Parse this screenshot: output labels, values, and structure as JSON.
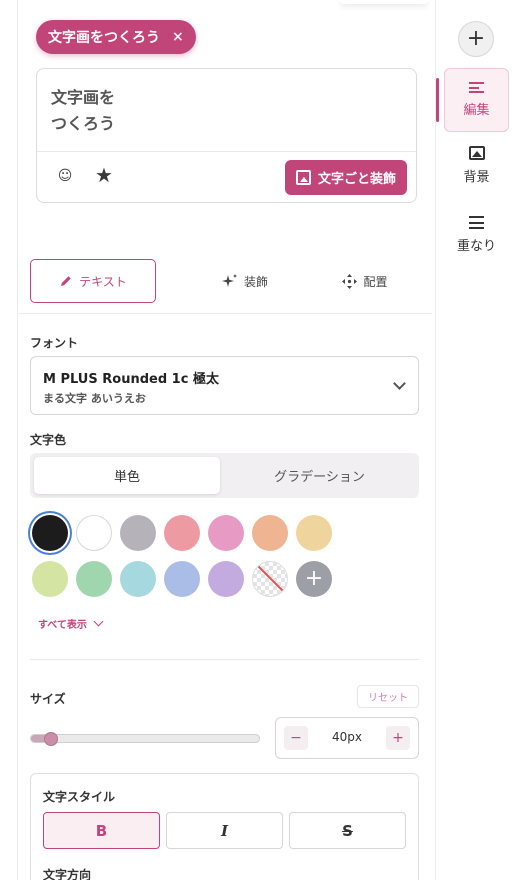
{
  "chip": {
    "label": "文字画をつくろう",
    "close": "×"
  },
  "editor": {
    "text": "文字画を\nつくろう",
    "emoji_icon": "☺",
    "star_icon": "★",
    "decorate_button": "文字ごと装飾"
  },
  "tabs": [
    {
      "label": "テキスト",
      "icon": "pencil-icon"
    },
    {
      "label": "装飾",
      "icon": "sparkle-icon"
    },
    {
      "label": "配置",
      "icon": "move-icon"
    }
  ],
  "font": {
    "label": "フォント",
    "name": "M PLUS Rounded 1c 極太",
    "sample": "まる文字 あいうえお"
  },
  "color": {
    "label": "文字色",
    "modes": [
      "単色",
      "グラデーション"
    ],
    "selected_mode": "単色",
    "swatches": [
      "#1c1c1c",
      "#ffffff",
      "#b5b2ba",
      "#ee9aa2",
      "#e79ac3",
      "#efb491",
      "#f0d49e",
      "#d3e4a3",
      "#9fd6ad",
      "#a5d8df",
      "#a9bde7",
      "#c3aadf",
      "none",
      "add"
    ],
    "selected_index": 0,
    "show_all": "すべて表示"
  },
  "size": {
    "label": "サイズ",
    "reset": "リセット",
    "value": "40px",
    "slider_fraction": 0.09,
    "minus": "−",
    "plus": "+"
  },
  "style": {
    "label": "文字スタイル",
    "bold": "B",
    "italic": "I",
    "strike": "S",
    "direction_label": "文字方向"
  },
  "rightbar": {
    "add": "+",
    "items": [
      {
        "label": "編集",
        "icon": "edit-lines-icon"
      },
      {
        "label": "背景",
        "icon": "image-icon"
      },
      {
        "label": "重なり",
        "icon": "list-icon"
      }
    ]
  },
  "colors": {
    "accent": "#c2457a"
  }
}
